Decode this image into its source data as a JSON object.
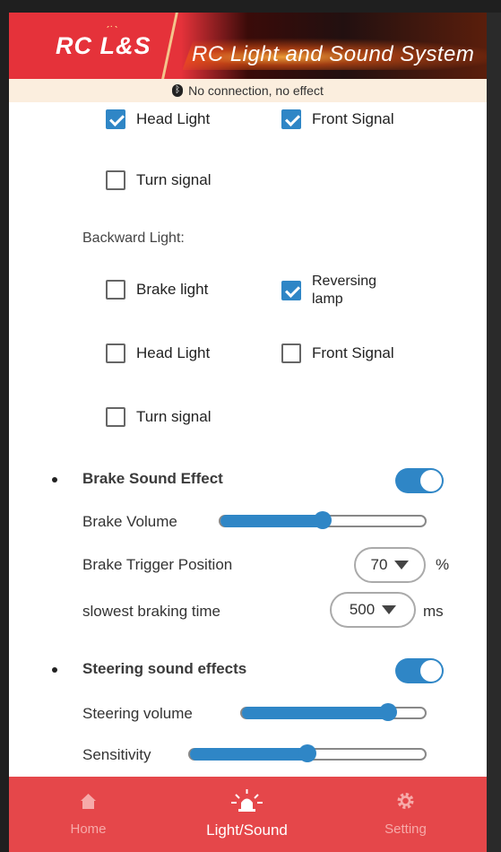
{
  "header": {
    "logo": "RC L&S",
    "title": "RC Light and Sound System"
  },
  "status": {
    "text": "No connection, no effect",
    "icon": "bluetooth-icon"
  },
  "forward_options": [
    {
      "label": "Head Light",
      "checked": true
    },
    {
      "label": "Front Signal",
      "checked": true
    },
    {
      "label": "Turn signal",
      "checked": false
    }
  ],
  "backward": {
    "label": "Backward Light:",
    "options": [
      {
        "label": "Brake light",
        "checked": false
      },
      {
        "label": "Reversing lamp",
        "checked": true
      },
      {
        "label": "Head Light",
        "checked": false
      },
      {
        "label": "Front Signal",
        "checked": false
      },
      {
        "label": "Turn signal",
        "checked": false
      }
    ]
  },
  "brake": {
    "title": "Brake Sound Effect",
    "enabled": true,
    "volume_label": "Brake Volume",
    "volume_fraction": 0.5,
    "trigger_label": "Brake Trigger Position",
    "trigger_value": "70",
    "trigger_unit": "%",
    "braking_label": "slowest braking time",
    "braking_value": "500",
    "braking_unit": "ms"
  },
  "steering": {
    "title": "Steering sound effects",
    "enabled": true,
    "volume_label": "Steering volume",
    "volume_fraction": 0.8,
    "sensitivity_label": "Sensitivity",
    "sensitivity_fraction": 0.5
  },
  "nav": [
    {
      "label": "Home",
      "icon": "home-icon",
      "active": false
    },
    {
      "label": "Light/Sound",
      "icon": "light-siren-icon",
      "active": true
    },
    {
      "label": "Setting",
      "icon": "gear-icon",
      "active": false
    }
  ],
  "colors": {
    "accent": "#2f86c6",
    "header_red": "#e5323a",
    "nav_red": "#e5474a"
  }
}
